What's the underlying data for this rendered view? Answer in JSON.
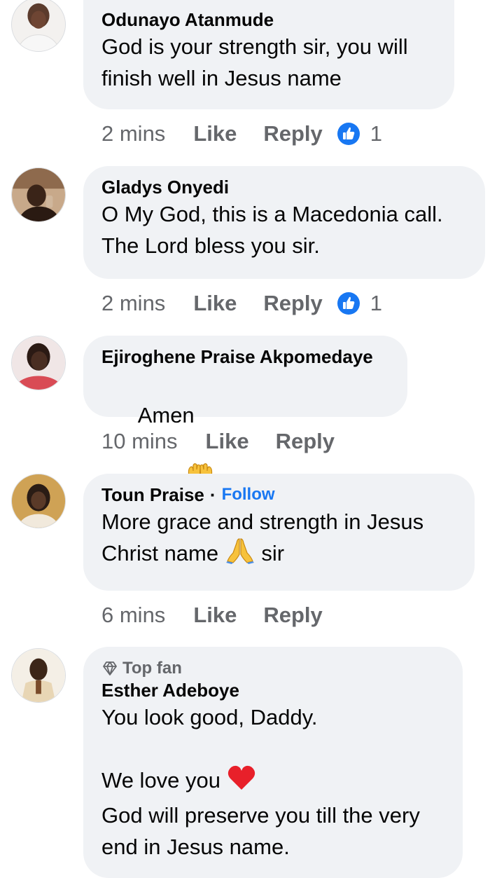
{
  "comments": [
    {
      "name": "Odunayo Atanmude",
      "text": "God is your strength sir, you will\nfinish well in Jesus name",
      "time": "2 mins",
      "like": "Like",
      "reply": "Reply",
      "reactions": "1",
      "avatar_icon": "user-avatar"
    },
    {
      "name": "Gladys Onyedi",
      "text": "O My God, this is a Macedonia call.\nThe Lord bless you sir.",
      "time": "2 mins",
      "like": "Like",
      "reply": "Reply",
      "reactions": "1",
      "avatar_icon": "user-avatar"
    },
    {
      "name": "Ejiroghene Praise Akpomedaye",
      "text": "Amen",
      "emoji": "raising-hands-icon",
      "time": "10 mins",
      "like": "Like",
      "reply": "Reply",
      "avatar_icon": "user-avatar"
    },
    {
      "name": "Toun Praise",
      "follow": "Follow",
      "text_a": "More grace and strength in Jesus",
      "text_b": "Christ name",
      "text_c": "sir",
      "emoji": "praying-hands-icon",
      "time": "6 mins",
      "like": "Like",
      "reply": "Reply",
      "avatar_icon": "user-avatar"
    },
    {
      "badge": "Top fan",
      "name": "Esther Adeboye",
      "text_a": "You look good, Daddy.",
      "text_b": "We love you",
      "text_c": "God will preserve you till the very\nend in Jesus name.",
      "emoji": "red-heart-icon",
      "avatar_icon": "user-avatar"
    }
  ],
  "colors": {
    "bubble": "#f0f2f5",
    "meta": "#65676b",
    "link": "#1877f2",
    "like_badge": "#1877f2"
  }
}
